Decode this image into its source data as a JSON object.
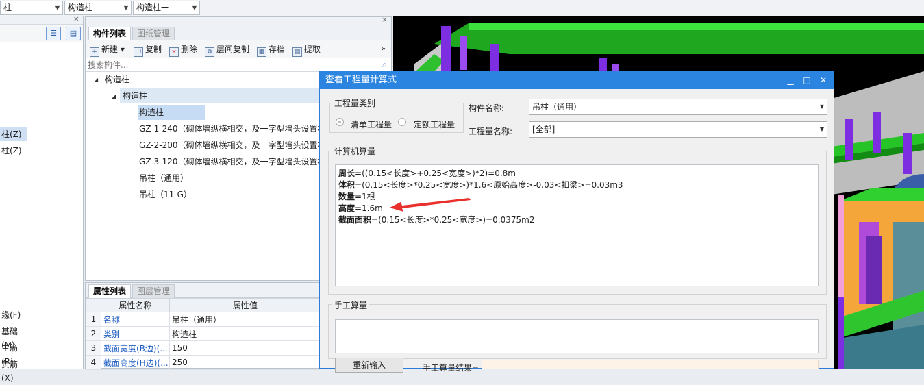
{
  "topbar": {
    "combo1": "柱",
    "combo2": "构造柱",
    "combo3": "构造柱一"
  },
  "leftnav": {
    "items": [
      "柱(Z)",
      "柱(Z)",
      "缘(F)",
      "基础(M)",
      "主筋(R)",
      "负筋(X)"
    ]
  },
  "component_panel": {
    "tabs": [
      "构件列表",
      "图纸管理"
    ],
    "toolbar": [
      "新建",
      "复制",
      "删除",
      "层间复制",
      "存档",
      "提取"
    ],
    "search_placeholder": "搜索构件...",
    "tree": [
      "构造柱",
      "构造柱",
      "构造柱一",
      "GZ-1-240（砌体墙纵横相交，及一字型墙头设置构",
      "GZ-2-200（砌体墙纵横相交，及一字型墙头设置构",
      "GZ-3-120（砌体墙纵横相交，及一字型墙头设置构",
      "吊柱（通用）",
      "吊柱（11-G）"
    ]
  },
  "property_panel": {
    "tabs": [
      "属性列表",
      "图层管理"
    ],
    "headers": [
      "属性名称",
      "属性值"
    ],
    "rows": [
      {
        "n": "1",
        "name": "名称",
        "value": "吊柱（通用）"
      },
      {
        "n": "2",
        "name": "类别",
        "value": "构造柱"
      },
      {
        "n": "3",
        "name": "截面宽度(B边)(...",
        "value": "150"
      },
      {
        "n": "4",
        "name": "截面高度(H边)(...",
        "value": "250"
      }
    ]
  },
  "dialog": {
    "title": "查看工程量计算式",
    "qty_type_group": "工程量类别",
    "radio1": "清单工程量",
    "radio2": "定额工程量",
    "component_name_label": "构件名称:",
    "component_name_value": "吊柱（通用）",
    "qty_name_label": "工程量名称:",
    "qty_name_value": "[全部]",
    "computer_calc_label": "计算机算量",
    "lines": [
      {
        "key": "周长",
        "expr": "=((0.15<长度>+0.25<宽度>)*2)=0.8m"
      },
      {
        "key": "体积",
        "expr": "=(0.15<长度>*0.25<宽度>)*1.6<原始高度>-0.03<扣梁>=0.03m3"
      },
      {
        "key": "数量",
        "expr": "=1根"
      },
      {
        "key": "高度",
        "expr": "=1.6m"
      },
      {
        "key": "截面面积",
        "expr": "=(0.15<长度>*0.25<宽度>)=0.0375m2"
      }
    ],
    "manual_calc_label": "手工算量",
    "reinput_button": "重新输入",
    "manual_result_label": "手工算量结果="
  },
  "colors": {
    "dialog_title": "#2b85e0",
    "arrow": "#e8302c",
    "viewport_bg": "#000000"
  }
}
